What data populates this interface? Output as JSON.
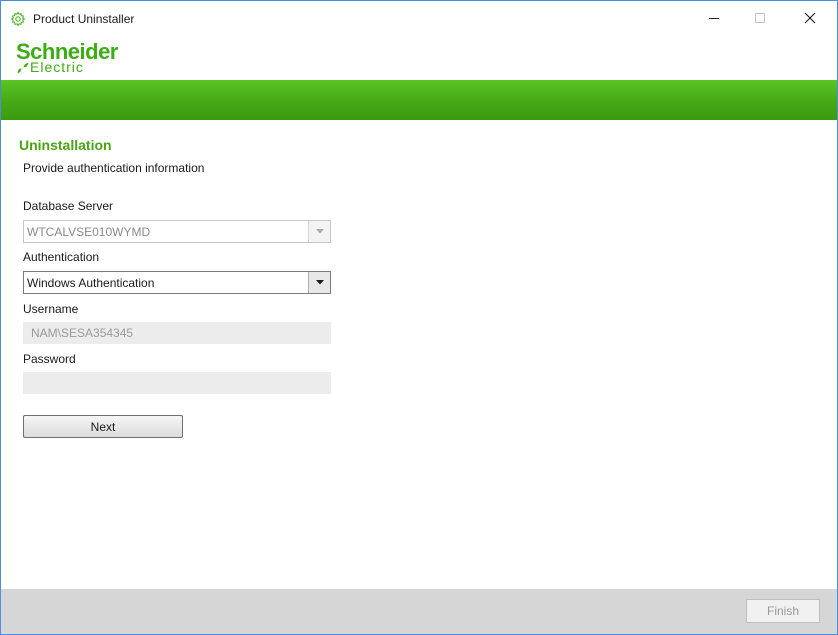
{
  "window": {
    "title": "Product Uninstaller",
    "controls": {
      "minimize": "—",
      "maximize": "☐",
      "close": "✕"
    }
  },
  "logo": {
    "main": "Schneider",
    "sub": "Electric",
    "brand_color": "#3dad14"
  },
  "section": {
    "title": "Uninstallation",
    "subtitle": "Provide authentication information"
  },
  "form": {
    "database_server": {
      "label": "Database Server",
      "value": "WTCALVSE010WYMD",
      "enabled": false
    },
    "authentication": {
      "label": "Authentication",
      "value": "Windows Authentication",
      "enabled": true
    },
    "username": {
      "label": "Username",
      "value": "NAM\\SESA354345",
      "enabled": false
    },
    "password": {
      "label": "Password",
      "value": "",
      "enabled": false
    }
  },
  "buttons": {
    "next": "Next",
    "finish": "Finish"
  },
  "colors": {
    "accent_green": "#45a916",
    "title_green": "#4aa516",
    "window_border": "#4a90d9",
    "footer": "#d6d6d6"
  },
  "icons": {
    "app": "gear-icon",
    "dropdown": "chevron-down-icon"
  }
}
